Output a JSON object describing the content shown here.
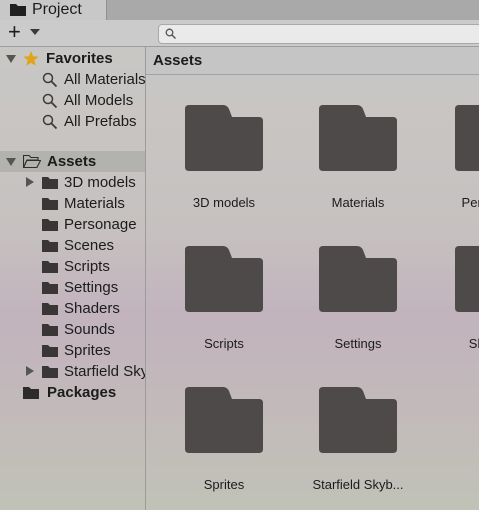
{
  "tab": {
    "label": "Project",
    "icon": "folder-icon"
  },
  "toolbar": {
    "add_label": "+",
    "search": {
      "placeholder": "",
      "icon": "search-icon"
    }
  },
  "sidebar": {
    "favorites": {
      "label": "Favorites",
      "icon": "star-icon",
      "items": [
        {
          "label": "All Materials",
          "icon": "search-icon"
        },
        {
          "label": "All Models",
          "icon": "search-icon"
        },
        {
          "label": "All Prefabs",
          "icon": "search-icon"
        }
      ]
    },
    "assets": {
      "label": "Assets",
      "icon": "folder-open-icon",
      "children": [
        {
          "label": "3D models",
          "expandable": true
        },
        {
          "label": "Materials",
          "expandable": false
        },
        {
          "label": "Personage",
          "expandable": false
        },
        {
          "label": "Scenes",
          "expandable": false
        },
        {
          "label": "Scripts",
          "expandable": false
        },
        {
          "label": "Settings",
          "expandable": false
        },
        {
          "label": "Shaders",
          "expandable": false
        },
        {
          "label": "Sounds",
          "expandable": false
        },
        {
          "label": "Sprites",
          "expandable": false
        },
        {
          "label": "Starfield Skybox",
          "expandable": true
        }
      ]
    },
    "packages": {
      "label": "Packages",
      "icon": "folder-icon"
    }
  },
  "main": {
    "header": "Assets",
    "tiles": [
      {
        "label": "3D models"
      },
      {
        "label": "Materials"
      },
      {
        "label": "Personage"
      },
      {
        "label": "Scripts"
      },
      {
        "label": "Settings"
      },
      {
        "label": "Shaders"
      },
      {
        "label": "Sprites"
      },
      {
        "label": "Starfield Skyb..."
      }
    ]
  },
  "colors": {
    "folder": "#4f4a4a",
    "selection": "#b2b2ae",
    "star": "#e0a31a"
  }
}
